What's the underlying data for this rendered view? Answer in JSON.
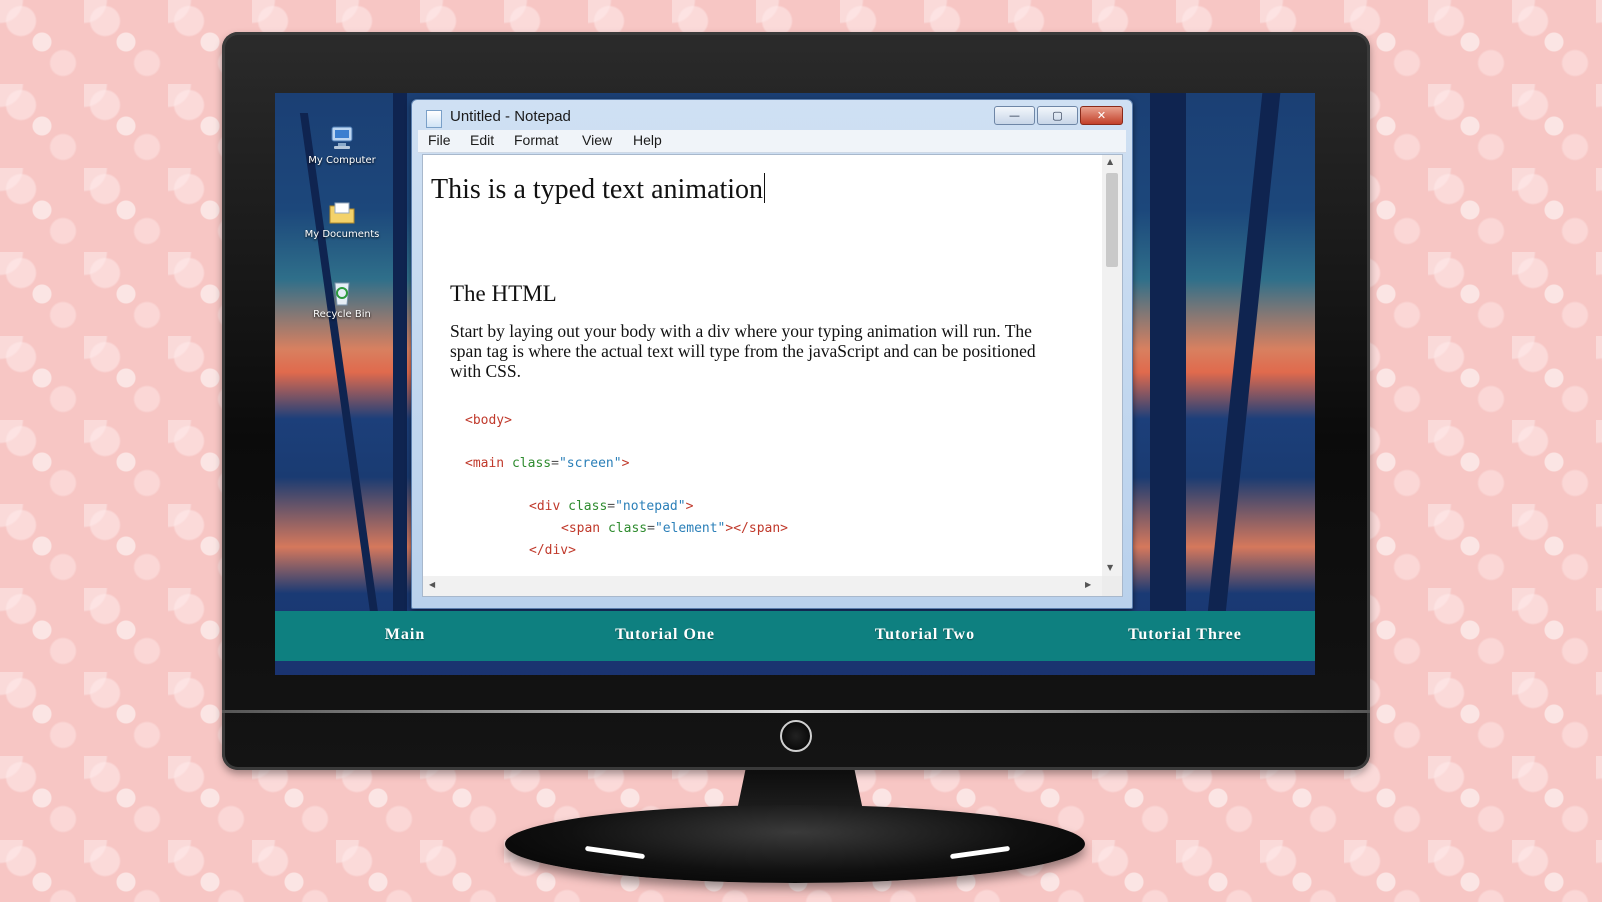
{
  "desktop": {
    "icons": [
      {
        "label": "My Computer",
        "icon": "computer-icon"
      },
      {
        "label": "My Documents",
        "icon": "folder-icon"
      },
      {
        "label": "Recycle Bin",
        "icon": "recycle-bin-icon"
      }
    ]
  },
  "notepad": {
    "title": "Untitled - Notepad",
    "window_buttons": {
      "minimize": "—",
      "maximize": "▢",
      "close": "✕"
    },
    "menu": [
      "File",
      "Edit",
      "Format",
      "View",
      "Help"
    ],
    "typed_text": "This is a typed text animation",
    "section_title": "The HTML",
    "section_paragraph": "Start by laying out your body with a div where your typing animation will run. The span tag is where the actual text will type from the javaScript and can be positioned with CSS.",
    "code": {
      "line1_tag": "<body>",
      "line2_open": "<main",
      "line2_attr": "class",
      "line2_val": "\"screen\"",
      "line2_close": ">",
      "line3_open": "<div",
      "line3_attr": "class",
      "line3_val": "\"notepad\"",
      "line3_close": ">",
      "line4_open": "<span",
      "line4_attr": "class",
      "line4_val": "\"element\"",
      "line4_close": "></span>",
      "line5_tag": "</div>"
    }
  },
  "nav": [
    "Main",
    "Tutorial One",
    "Tutorial Two",
    "Tutorial Three"
  ],
  "colors": {
    "nav_bg": "#0e8080",
    "tag": "#c0392b",
    "attr": "#2e8b2e",
    "val": "#2a7fb8"
  }
}
